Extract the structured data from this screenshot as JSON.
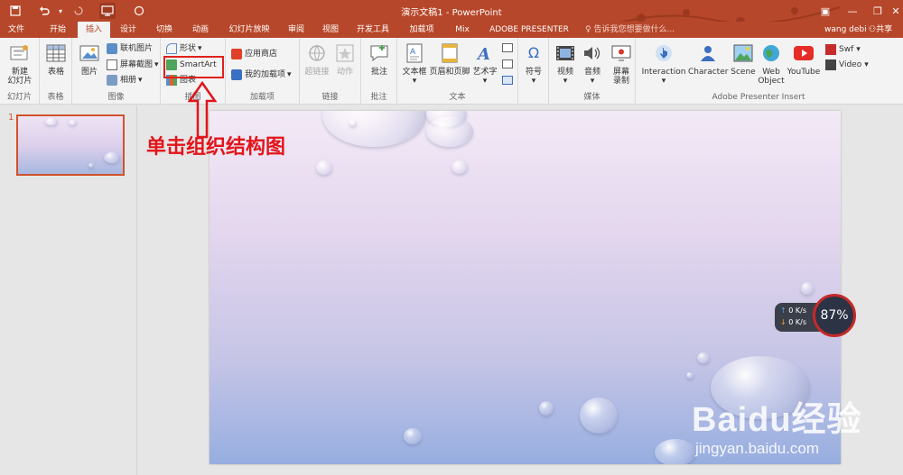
{
  "window": {
    "title": "演示文稿1 - PowerPoint",
    "accent": "#b7472a"
  },
  "quick_access": {
    "save_icon": "save-icon",
    "undo_icon": "undo-icon",
    "redo_icon": "redo-icon",
    "present_icon": "present-from-start-icon",
    "circle_icon": "circle-icon"
  },
  "tabs": [
    {
      "label": "文件"
    },
    {
      "label": "开始"
    },
    {
      "label": "插入"
    },
    {
      "label": "设计"
    },
    {
      "label": "切换"
    },
    {
      "label": "动画"
    },
    {
      "label": "幻灯片放映"
    },
    {
      "label": "审阅"
    },
    {
      "label": "视图"
    },
    {
      "label": "开发工具"
    },
    {
      "label": "加载项"
    },
    {
      "label": "Mix"
    },
    {
      "label": "ADOBE PRESENTER"
    }
  ],
  "tell_me": "告诉我您想要做什么...",
  "user": "wang debi",
  "share": "共享",
  "ribbon": {
    "slides": {
      "new_slide": "新建\n幻灯片",
      "group": "幻灯片"
    },
    "tables": {
      "table": "表格",
      "group": "表格"
    },
    "images": {
      "picture": "图片",
      "online_picture": "联机图片",
      "screenshot": "屏幕截图",
      "album": "相册",
      "group": "图像"
    },
    "illustrations": {
      "shapes": "形状",
      "smartart": "SmartArt",
      "chart": "图表",
      "group": "插图"
    },
    "addins": {
      "store": "应用商店",
      "my_addins": "我的加载项",
      "group": "加载项"
    },
    "links": {
      "hyperlink": "超链接",
      "action": "动作",
      "group": "链接"
    },
    "comments": {
      "comment": "批注",
      "group": "批注"
    },
    "text": {
      "textbox": "文本框",
      "header_footer": "页眉和页脚",
      "wordart": "艺术字",
      "group": "文本"
    },
    "symbols": {
      "symbol": "符号",
      "group": ""
    },
    "media": {
      "video": "视频",
      "audio": "音频",
      "screen_record": "屏幕\n录制",
      "group": "媒体"
    },
    "presenter": {
      "interaction": "Interaction",
      "character": "Character",
      "scene": "Scene",
      "web_object": "Web\nObject",
      "youtube": "YouTube",
      "swf": "Swf",
      "video": "Video",
      "group": "Adobe Presenter Insert"
    }
  },
  "slides_pane": {
    "slide_number": "1"
  },
  "annotation": "单击组织结构图",
  "net_widget": {
    "up": "0 K/s",
    "down": "0 K/s",
    "percent": "87%"
  },
  "watermark": {
    "logo": "Baidu经验",
    "url": "jingyan.baidu.com"
  }
}
